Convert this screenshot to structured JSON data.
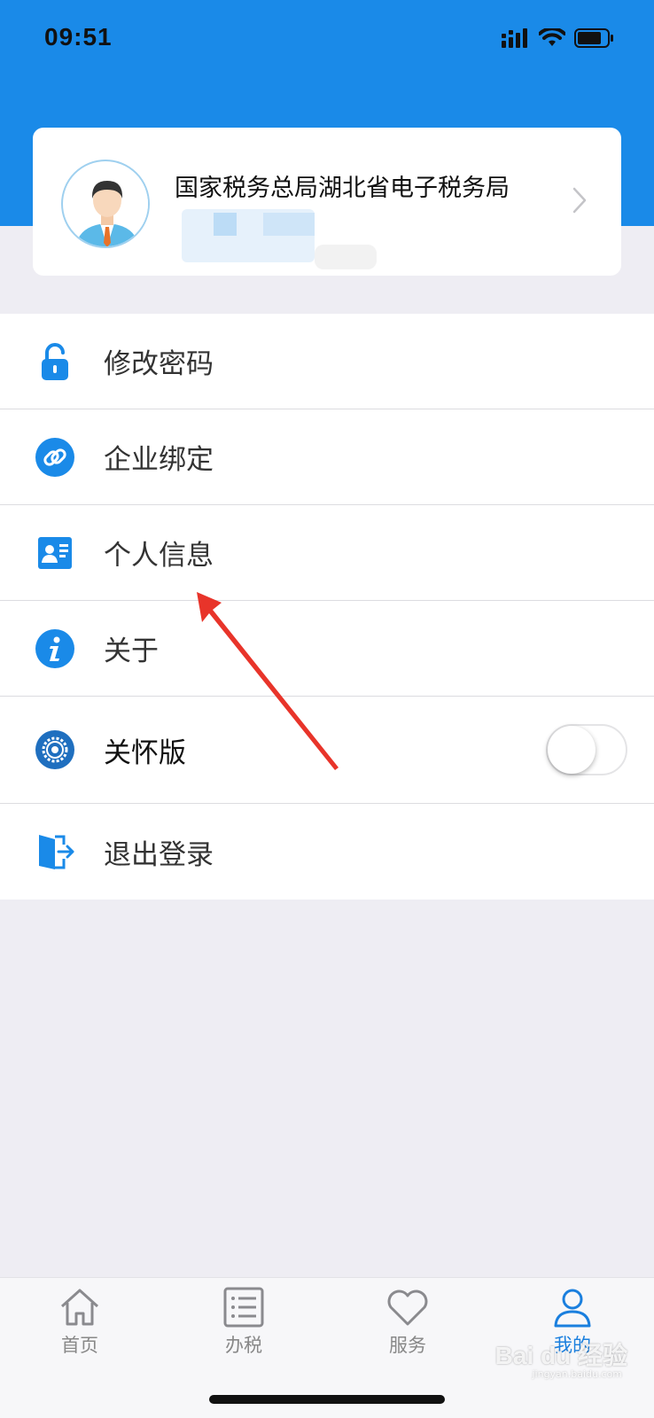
{
  "status_bar": {
    "time": "09:51",
    "icons": [
      "signal-icon",
      "wifi-icon",
      "battery-icon"
    ]
  },
  "profile": {
    "name": "国家税务总局湖北省电子税务局",
    "avatar_icon": "user-avatar-icon",
    "chevron_icon": "chevron-right-icon"
  },
  "menu": {
    "items": [
      {
        "label": "修改密码",
        "icon": "lock-icon"
      },
      {
        "label": "企业绑定",
        "icon": "link-icon"
      },
      {
        "label": "个人信息",
        "icon": "id-card-icon"
      },
      {
        "label": "关于",
        "icon": "info-icon"
      },
      {
        "label": "关怀版",
        "icon": "gear-icon",
        "toggle_on": false
      },
      {
        "label": "退出登录",
        "icon": "logout-door-icon"
      }
    ]
  },
  "tabbar": {
    "tabs": [
      {
        "label": "首页",
        "icon": "home-icon",
        "active": false
      },
      {
        "label": "办税",
        "icon": "list-icon",
        "active": false
      },
      {
        "label": "服务",
        "icon": "heart-icon",
        "active": false
      },
      {
        "label": "我的",
        "icon": "person-icon",
        "active": true
      }
    ]
  },
  "watermark": {
    "text": "Bai du 经验",
    "sub": "jingyan.baidu.com"
  },
  "colors": {
    "brand_blue": "#1a8ae8",
    "active_tab": "#1a7fde",
    "page_bg": "#eeedf3",
    "arrow_red": "#e8342a"
  }
}
